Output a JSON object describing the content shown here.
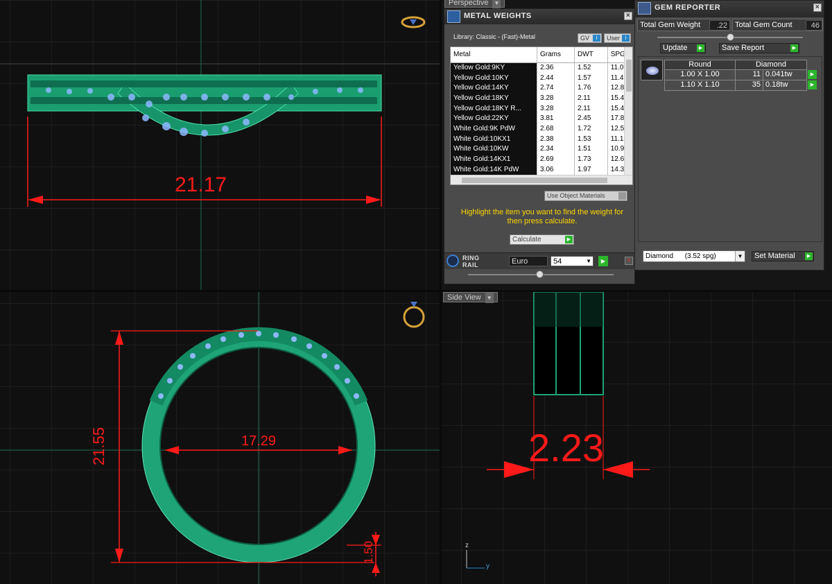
{
  "viewports": {
    "perspective_label": "Perspective",
    "side_view_label": "Side View",
    "dim_width": "21.17",
    "dim_outer": "21.55",
    "dim_inner": "17.29",
    "dim_thickness": "1.50",
    "dim_side": "2.23",
    "axis_z": "z",
    "axis_y": "y"
  },
  "metal_weights": {
    "title": "METAL WEIGHTS",
    "library": "Library: Classic - (Fast)-Metal",
    "gv_label": "GV",
    "user_label": "User",
    "columns": [
      "Metal",
      "Grams",
      "DWT",
      "SPG"
    ],
    "rows": [
      [
        "Yellow Gold:9KY",
        "2.36",
        "1.52",
        "11.0"
      ],
      [
        "Yellow Gold:10KY",
        "2.44",
        "1.57",
        "11.4"
      ],
      [
        "Yellow Gold:14KY",
        "2.74",
        "1.76",
        "12.8"
      ],
      [
        "Yellow Gold:18KY",
        "3.28",
        "2.11",
        "15.4"
      ],
      [
        "Yellow Gold:18KY R...",
        "3.28",
        "2.11",
        "15.4"
      ],
      [
        "Yellow Gold:22KY",
        "3.81",
        "2.45",
        "17.8"
      ],
      [
        "White Gold:9K PdW",
        "2.68",
        "1.72",
        "12.5"
      ],
      [
        "White Gold:10KX1",
        "2.38",
        "1.53",
        "11.1"
      ],
      [
        "White Gold:10KW",
        "2.34",
        "1.51",
        "10.9"
      ],
      [
        "White Gold:14KX1",
        "2.69",
        "1.73",
        "12.6"
      ],
      [
        "White Gold:14K PdW",
        "3.06",
        "1.97",
        "14.3"
      ]
    ],
    "use_object_materials": "Use Object Materials",
    "hint": "Highlight the item you want to find the weight for then press calculate.",
    "calculate_label": "Calculate"
  },
  "ring_rail": {
    "title": "RING RAIL",
    "system": "Euro",
    "size": "54"
  },
  "gem_reporter": {
    "title": "GEM REPORTER",
    "total_weight_label": "Total Gem Weight",
    "total_weight_value": ".22",
    "total_count_label": "Total Gem Count",
    "total_count_value": "46",
    "update_label": "Update",
    "save_report_label": "Save Report",
    "gem_headers": [
      "Round",
      "Diamond"
    ],
    "gem_rows": [
      {
        "size": "1.00 X 1.00",
        "count": "11",
        "weight": "0.041tw"
      },
      {
        "size": "1.10 X 1.10",
        "count": "35",
        "weight": "0.18tw"
      }
    ],
    "material_select": "Diamond      (3.52 spg)",
    "set_material_label": "Set Material"
  },
  "colors": {
    "ring_green": "#1ea476",
    "dimension_red": "#ff1a1a",
    "hint_yellow": "#ffd800",
    "grid": "#2c2c2c"
  }
}
